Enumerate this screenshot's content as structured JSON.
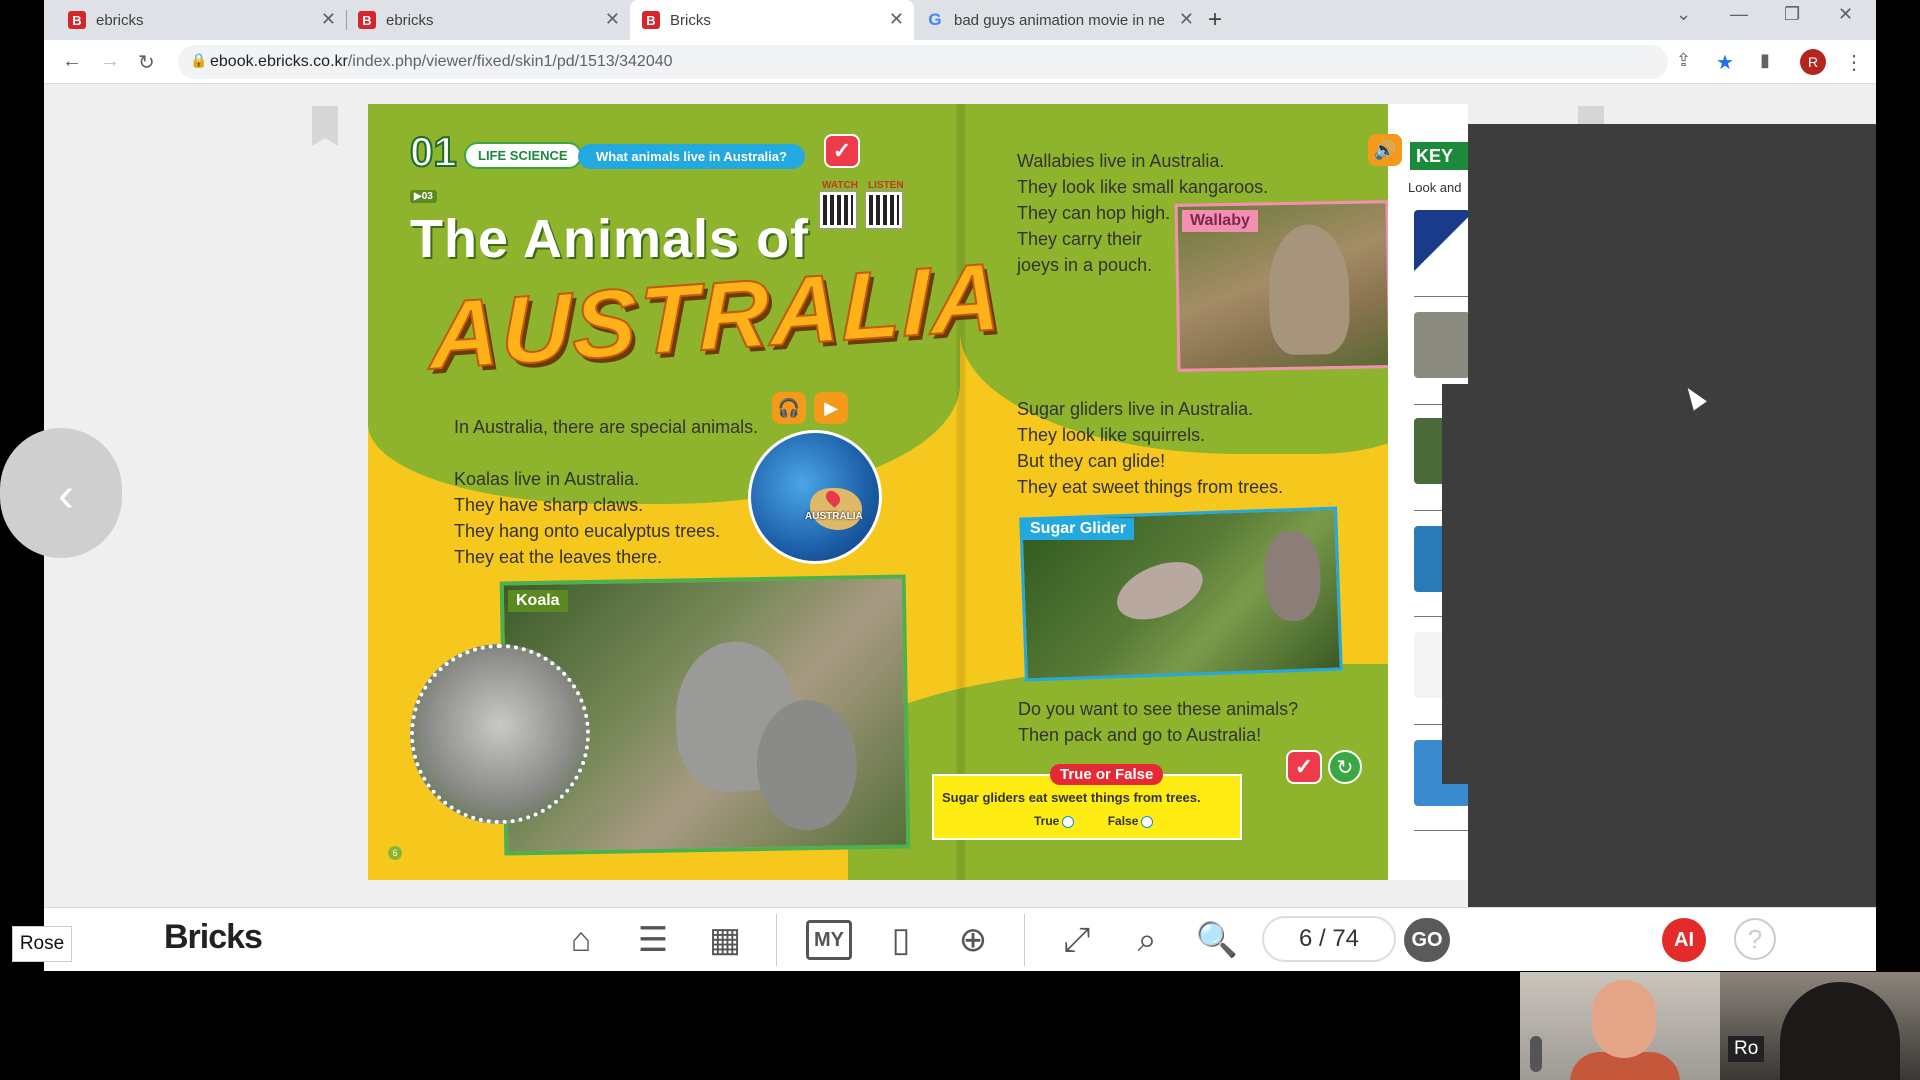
{
  "browser": {
    "tabs": [
      {
        "title": "ebricks",
        "icon": "B"
      },
      {
        "title": "ebricks",
        "icon": "B"
      },
      {
        "title": "Bricks",
        "icon": "B"
      },
      {
        "title": "bad guys animation movie in net",
        "icon": "G"
      }
    ],
    "active_tab": 2,
    "url_host": "ebook.ebricks.co.kr",
    "url_path": "/index.php/viewer/fixed/skin1/pd/1513/342040",
    "profile_initial": "R"
  },
  "book": {
    "unit_number": "01",
    "unit_tag": "LIFE SCIENCE",
    "question_banner": "What animals live in Australia?",
    "track_code": "▶03",
    "watch_label": "WATCH",
    "listen_label": "LISTEN",
    "title_line1": "The Animals of",
    "title_line2": "AUSTRALIA",
    "intro_line": "In Australia, there are special animals.",
    "koala_lines": [
      "Koalas live in Australia.",
      "They have sharp claws.",
      "They hang onto eucalyptus trees.",
      "They eat the leaves there."
    ],
    "globe_label": "AUSTRALIA",
    "koala_tag": "Koala",
    "page_number_left": "6",
    "wallaby_lines": [
      "Wallabies live in Australia.",
      "They look like small kangaroos.",
      "They can hop high.",
      "They carry their",
      "joeys in a pouch."
    ],
    "wallaby_tag": "Wallaby",
    "glider_lines": [
      "Sugar gliders live in Australia.",
      "They look like squirrels.",
      "But they can glide!",
      "They eat sweet things from trees."
    ],
    "glider_tag": "Sugar Glider",
    "closing_lines": [
      "Do you want to see these animals?",
      "Then pack and go to Australia!"
    ],
    "true_false": {
      "label": "True or False",
      "question": "Sugar gliders eat sweet things from trees.",
      "true_label": "True",
      "false_label": "False"
    },
    "key_words_head": "KEY W",
    "key_words_sub": "Look and"
  },
  "viewer": {
    "brand": "Bricks",
    "page_indicator": "6 / 74",
    "go_label": "GO",
    "ai_label": "AI",
    "help_label": "?"
  },
  "participants": {
    "self_label": "Rose",
    "other_label": "Ro"
  },
  "colors": {
    "page_yellow": "#f6c81d",
    "page_green": "#8db42c",
    "brand_red": "#e23a3a"
  }
}
